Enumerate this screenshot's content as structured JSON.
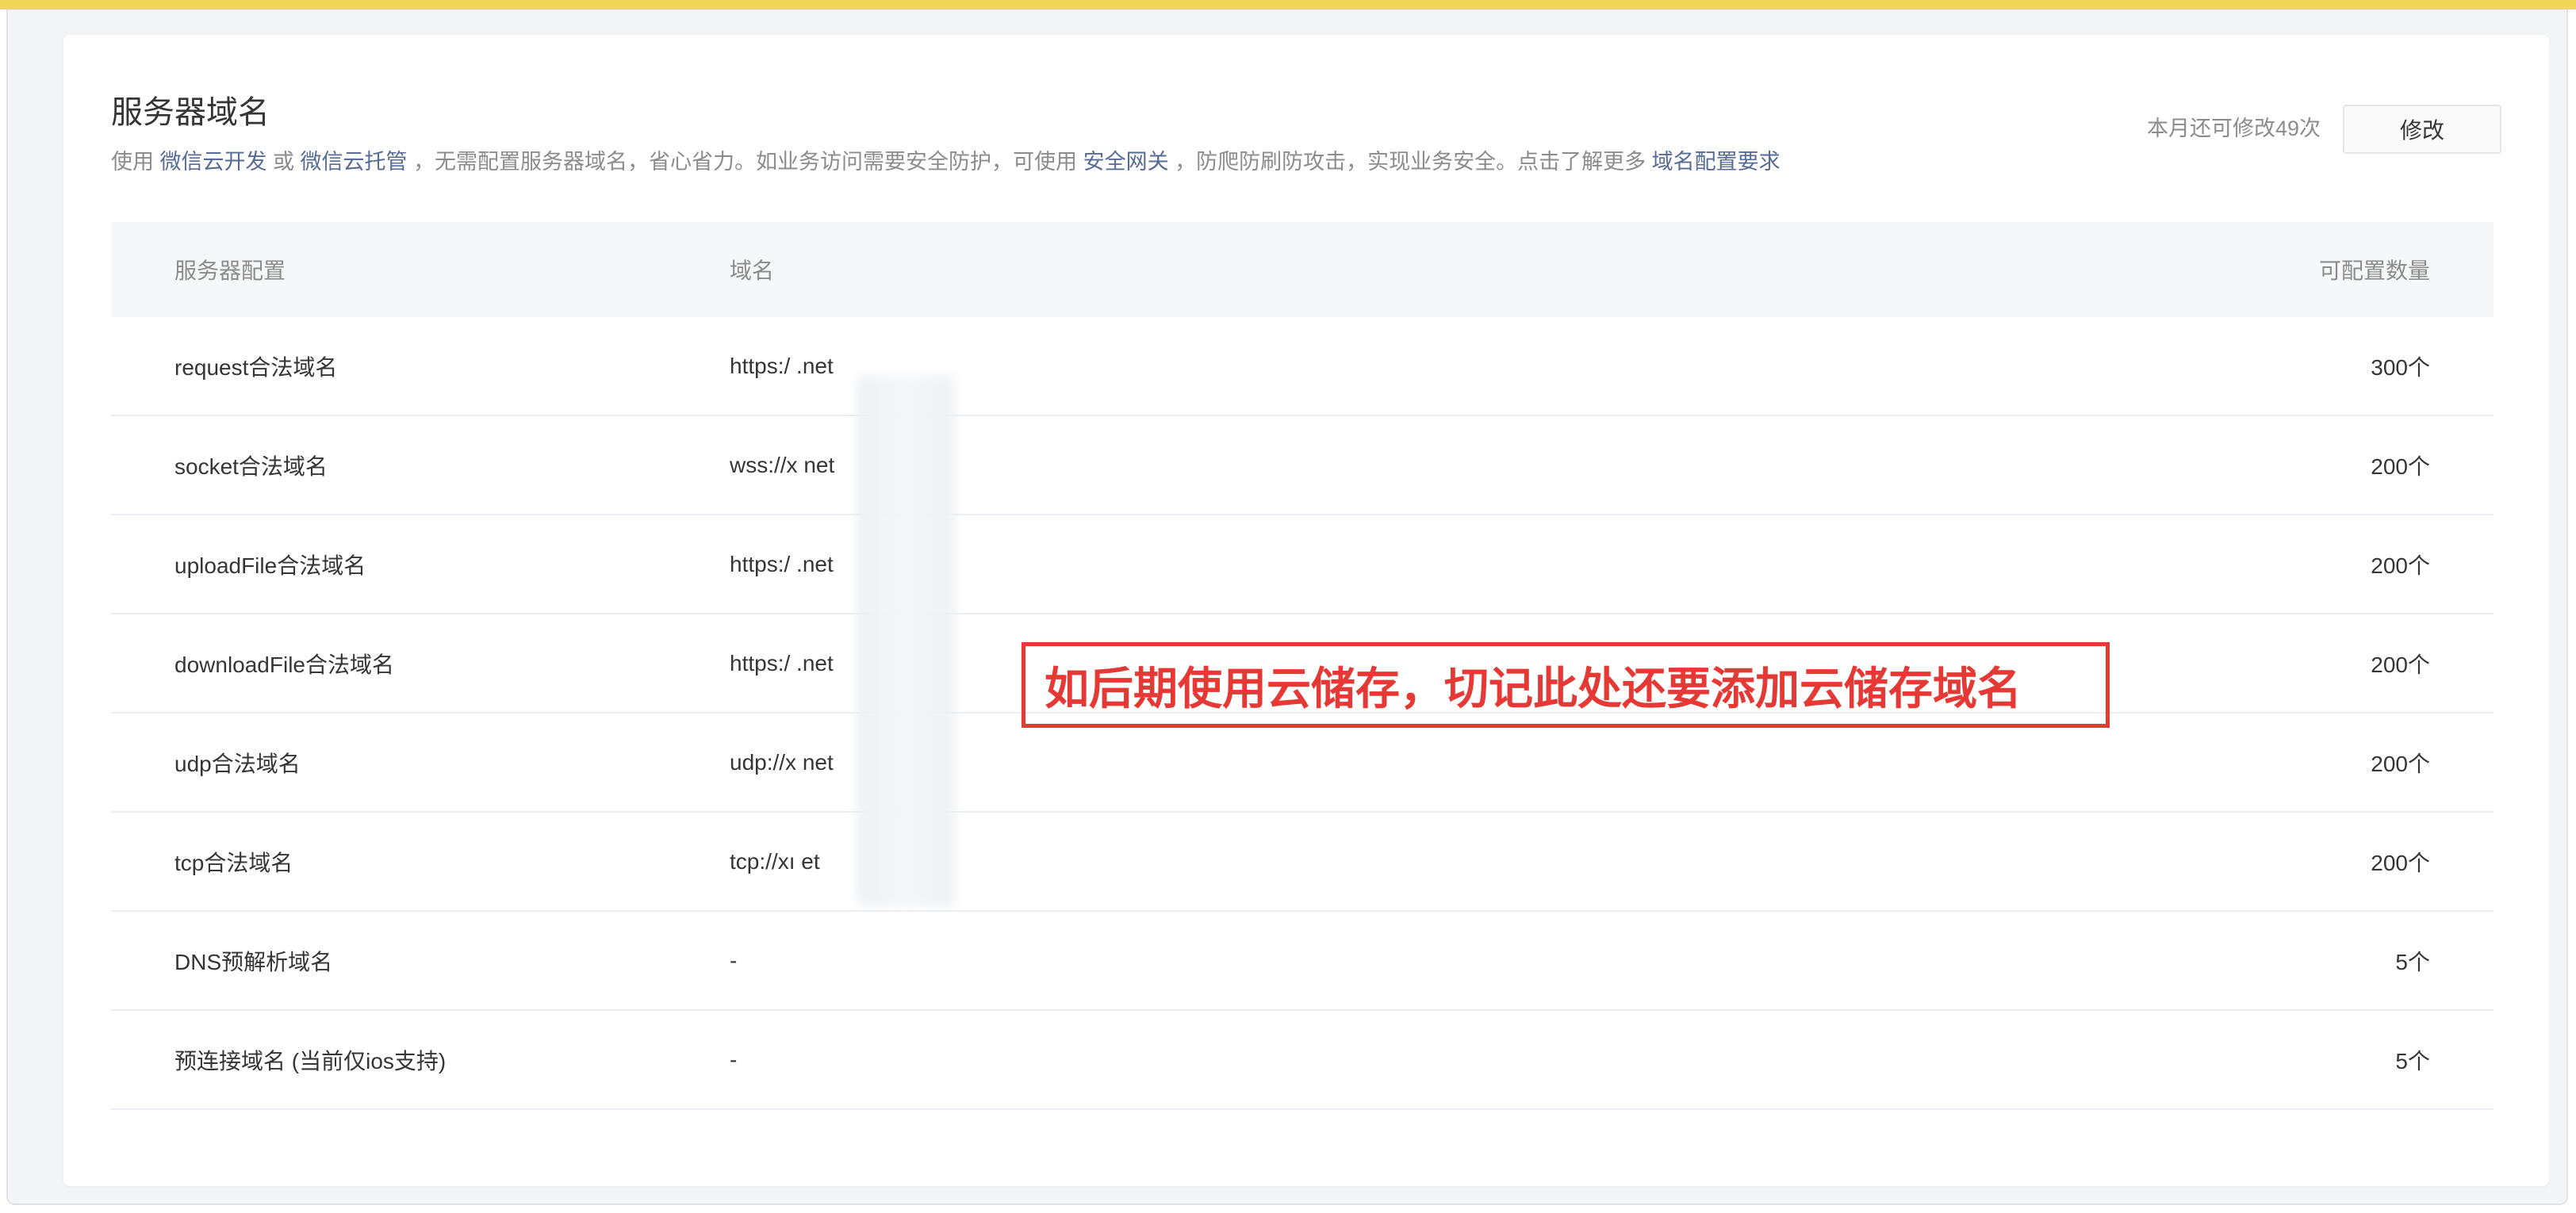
{
  "page": {
    "title": "服务器域名",
    "desc": {
      "p1": "使用",
      "link1": "微信云开发",
      "p2": "或",
      "link2": "微信云托管",
      "p3": "，无需配置服务器域名，省心省力。如业务访问需要安全防护，可使用",
      "link3": "安全网关",
      "p4": "，防爬防刷防攻击，实现业务安全。点击了解更多",
      "link4": "域名配置要求"
    },
    "quota_text": "本月还可修改49次",
    "edit_label": "修改"
  },
  "table": {
    "headers": [
      "服务器配置",
      "域名",
      "可配置数量"
    ],
    "rows": [
      {
        "config": "request合法域名",
        "domain": "https:/          .net",
        "count": "300个"
      },
      {
        "config": "socket合法域名",
        "domain": "wss://x          net",
        "count": "200个"
      },
      {
        "config": "uploadFile合法域名",
        "domain": "https:/          .net",
        "count": "200个"
      },
      {
        "config": "downloadFile合法域名",
        "domain": "https:/          .net",
        "count": "200个"
      },
      {
        "config": "udp合法域名",
        "domain": "udp://x          net",
        "count": "200个"
      },
      {
        "config": "tcp合法域名",
        "domain": "tcp://xı          et",
        "count": "200个"
      },
      {
        "config": "DNS预解析域名",
        "domain": "-",
        "count": "5个"
      },
      {
        "config": "预连接域名 (当前仅ios支持)",
        "domain": "-",
        "count": "5个"
      }
    ]
  },
  "annotation": {
    "text": "如后期使用云储存，切记此处还要添加云储存域名",
    "color": "#e53935"
  },
  "colors": {
    "top_accent": "#f0d558",
    "link": "#576b95",
    "text_primary": "#353535",
    "text_secondary": "#8c8c8c"
  }
}
